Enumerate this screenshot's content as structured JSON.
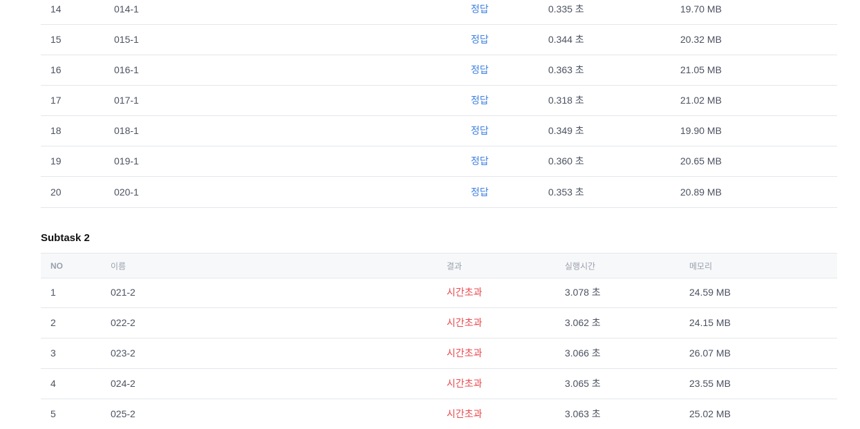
{
  "subtask1": {
    "rows": [
      {
        "no": "14",
        "name": "014-1",
        "result": "정답",
        "time": "0.335 초",
        "memory": "19.70 MB"
      },
      {
        "no": "15",
        "name": "015-1",
        "result": "정답",
        "time": "0.344 초",
        "memory": "20.32 MB"
      },
      {
        "no": "16",
        "name": "016-1",
        "result": "정답",
        "time": "0.363 초",
        "memory": "21.05 MB"
      },
      {
        "no": "17",
        "name": "017-1",
        "result": "정답",
        "time": "0.318 초",
        "memory": "21.02 MB"
      },
      {
        "no": "18",
        "name": "018-1",
        "result": "정답",
        "time": "0.349 초",
        "memory": "19.90 MB"
      },
      {
        "no": "19",
        "name": "019-1",
        "result": "정답",
        "time": "0.360 초",
        "memory": "20.65 MB"
      },
      {
        "no": "20",
        "name": "020-1",
        "result": "정답",
        "time": "0.353 초",
        "memory": "20.89 MB"
      }
    ]
  },
  "subtask2": {
    "title": "Subtask 2",
    "headers": {
      "no": "NO",
      "name": "이름",
      "result": "결과",
      "time": "실행시간",
      "memory": "메모리"
    },
    "rows": [
      {
        "no": "1",
        "name": "021-2",
        "result": "시간초과",
        "time": "3.078 초",
        "memory": "24.59 MB"
      },
      {
        "no": "2",
        "name": "022-2",
        "result": "시간초과",
        "time": "3.062 초",
        "memory": "24.15 MB"
      },
      {
        "no": "3",
        "name": "023-2",
        "result": "시간초과",
        "time": "3.066 초",
        "memory": "26.07 MB"
      },
      {
        "no": "4",
        "name": "024-2",
        "result": "시간초과",
        "time": "3.065 초",
        "memory": "23.55 MB"
      },
      {
        "no": "5",
        "name": "025-2",
        "result": "시간초과",
        "time": "3.063 초",
        "memory": "25.02 MB"
      }
    ]
  },
  "colors": {
    "accepted": "#3d7fe0",
    "time_limit": "#e8484d"
  }
}
